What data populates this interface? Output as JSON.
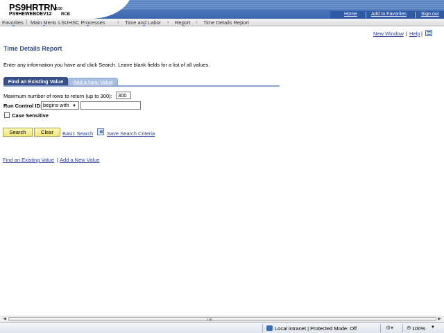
{
  "header": {
    "db_name": "PS9HRTRN",
    "db_version": "8.50",
    "server_name": "PS9HEWEBDEV12",
    "user_id": "RCB",
    "links": [
      "Home",
      "Add to Favorites",
      "Sign out"
    ]
  },
  "breadcrumb": [
    "Favorites",
    "Main Menu",
    "LSUHSC Processes",
    "Time and Labor",
    "Report",
    "Time Details Report"
  ],
  "page_links": {
    "new_window": "New Window",
    "help": "Help",
    "separator": "|"
  },
  "page": {
    "title": "Time Details Report",
    "instructions": "Enter any information you have and click Search. Leave blank fields for a list of all values.",
    "tabs": [
      "Find an Existing Value",
      "Add a New Value"
    ],
    "max_rows_label": "Maximum number of rows to return (up to 300):",
    "max_rows_value": "300",
    "run_control_label": "Run Control ID:",
    "run_control_operator": "begins with",
    "run_control_value": "",
    "case_sensitive_label": "Case Sensitive",
    "case_sensitive_checked": false,
    "search_button": "Search",
    "clear_button": "Clear",
    "basic_search_link": "Basic Search",
    "save_criteria_link": "Save Search Criteria",
    "footer_links": [
      "Find an Existing Value",
      "Add a New Value"
    ]
  },
  "statusbar": {
    "zone": "Local intranet | Protected Mode: Off",
    "zoom": "100%"
  },
  "colors": {
    "title": "#2d4d8c",
    "link": "#2c3f99",
    "header_blue": "#3a67b0",
    "active_tab": "#374f8a",
    "button_yellow": "#f1e47a"
  }
}
